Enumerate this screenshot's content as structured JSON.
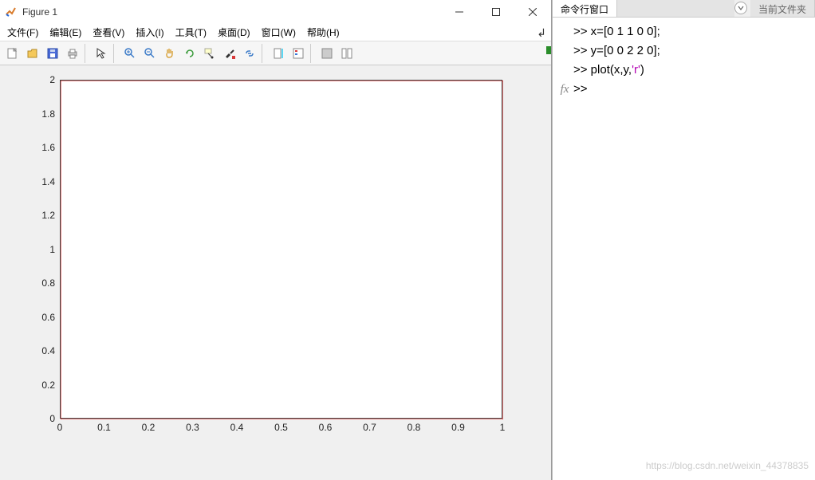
{
  "figure": {
    "title": "Figure 1",
    "menus": [
      "文件(F)",
      "编辑(E)",
      "查看(V)",
      "插入(I)",
      "工具(T)",
      "桌面(D)",
      "窗口(W)",
      "帮助(H)"
    ],
    "toolbar_icons": [
      "new",
      "open",
      "save",
      "print",
      "arrow",
      "zoom-in",
      "zoom-out",
      "pan",
      "rotate",
      "datacursor",
      "brush",
      "link",
      "colorbar",
      "legend",
      "insert",
      "tile"
    ]
  },
  "chart_data": {
    "type": "line",
    "x": [
      0,
      1,
      1,
      0,
      0
    ],
    "y": [
      0,
      0,
      2,
      2,
      0
    ],
    "color": "r",
    "xlim": [
      0,
      1
    ],
    "ylim": [
      0,
      2
    ],
    "xticks": [
      0,
      0.1,
      0.2,
      0.3,
      0.4,
      0.5,
      0.6,
      0.7,
      0.8,
      0.9,
      1
    ],
    "yticks": [
      0,
      0.2,
      0.4,
      0.6,
      0.8,
      1,
      1.2,
      1.4,
      1.6,
      1.8,
      2
    ],
    "title": "",
    "xlabel": "",
    "ylabel": ""
  },
  "ide": {
    "tabs": {
      "active": "命令行窗口",
      "inactive": "当前文件夹"
    },
    "lines": [
      {
        "prompt": ">> ",
        "code": "x=[0 1 1 0 0];"
      },
      {
        "prompt": ">> ",
        "code": "y=[0 0 2 2 0];"
      },
      {
        "prompt": ">> ",
        "code_pre": "plot(x,y,",
        "code_str": "'r'",
        "code_post": ")"
      },
      {
        "fx": true,
        "prompt": ">> ",
        "code": ""
      }
    ],
    "watermark": "https://blog.csdn.net/weixin_44378835"
  }
}
